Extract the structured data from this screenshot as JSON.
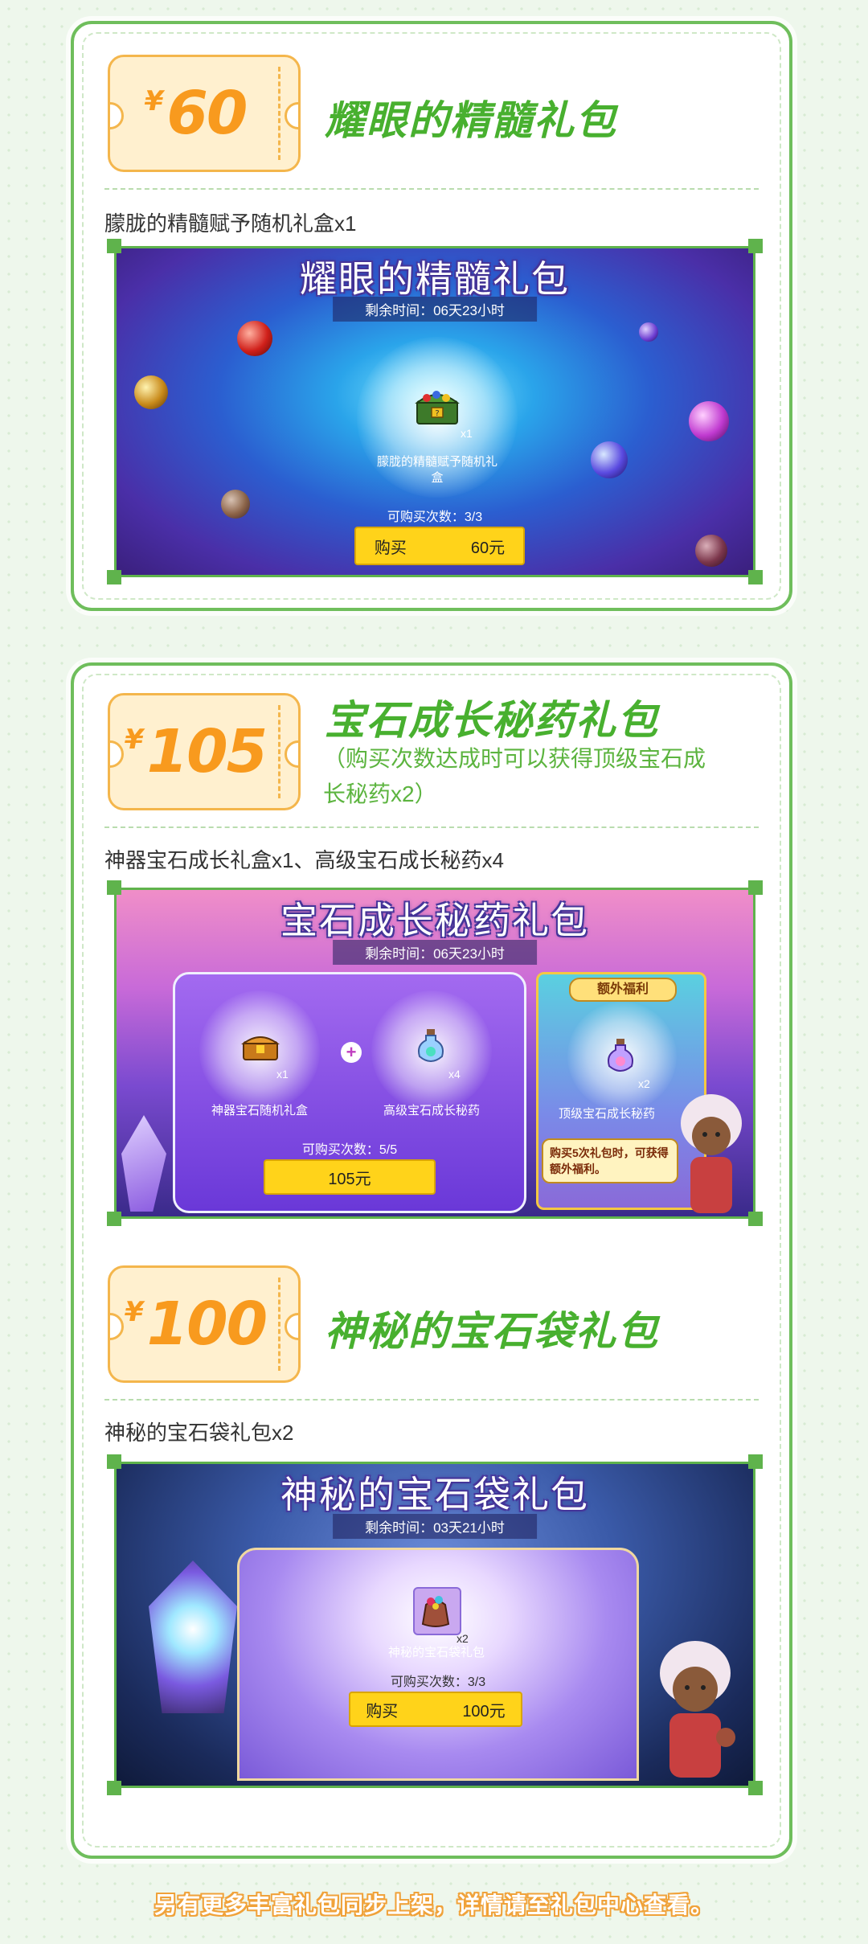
{
  "packages": [
    {
      "currency": "¥",
      "price": "60",
      "title": "耀眼的精髓礼包",
      "note": "",
      "contents": "朦胧的精髓赋予随机礼盒x1",
      "screen": {
        "title": "耀眼的精髓礼包",
        "timer": "剩余时间：06天23小时",
        "item_name": "朦胧的精髓赋予随机礼盒",
        "item_count": "x1",
        "limit": "可购买次数：3/3",
        "buy_label": "购买",
        "buy_price": "60元"
      }
    },
    {
      "currency": "¥",
      "price": "105",
      "title": "宝石成长秘药礼包",
      "note": "（购买次数达成时可以获得顶级宝石成长秘药x2）",
      "contents": "神器宝石成长礼盒x1、高级宝石成长秘药x4",
      "screen": {
        "title": "宝石成长秘药礼包",
        "timer": "剩余时间：06天23小时",
        "items": [
          {
            "name": "神器宝石随机礼盒",
            "count": "x1"
          },
          {
            "name": "高级宝石成长秘药",
            "count": "x4"
          }
        ],
        "limit": "可购买次数：5/5",
        "buy_price": "105元",
        "bonus_label": "额外福利",
        "bonus_item": {
          "name": "顶级宝石成长秘药",
          "count": "x2"
        },
        "bonus_hint": "购买5次礼包时，可获得额外福利。"
      }
    },
    {
      "currency": "¥",
      "price": "100",
      "title": "神秘的宝石袋礼包",
      "note": "",
      "contents": "神秘的宝石袋礼包x2",
      "screen": {
        "title": "神秘的宝石袋礼包",
        "timer": "剩余时间：03天21小时",
        "item_name": "神秘的宝石袋礼包",
        "item_count": "x2",
        "limit": "可购买次数：3/3",
        "buy_label": "购买",
        "buy_price": "100元"
      }
    }
  ],
  "footer": "另有更多丰富礼包同步上架，详情请至礼包中心查看。",
  "colors": {
    "frame_green": "#6fbe5c",
    "title_green": "#48b02f",
    "price_orange": "#f89a1e",
    "button_yellow": "#ffd31a"
  }
}
